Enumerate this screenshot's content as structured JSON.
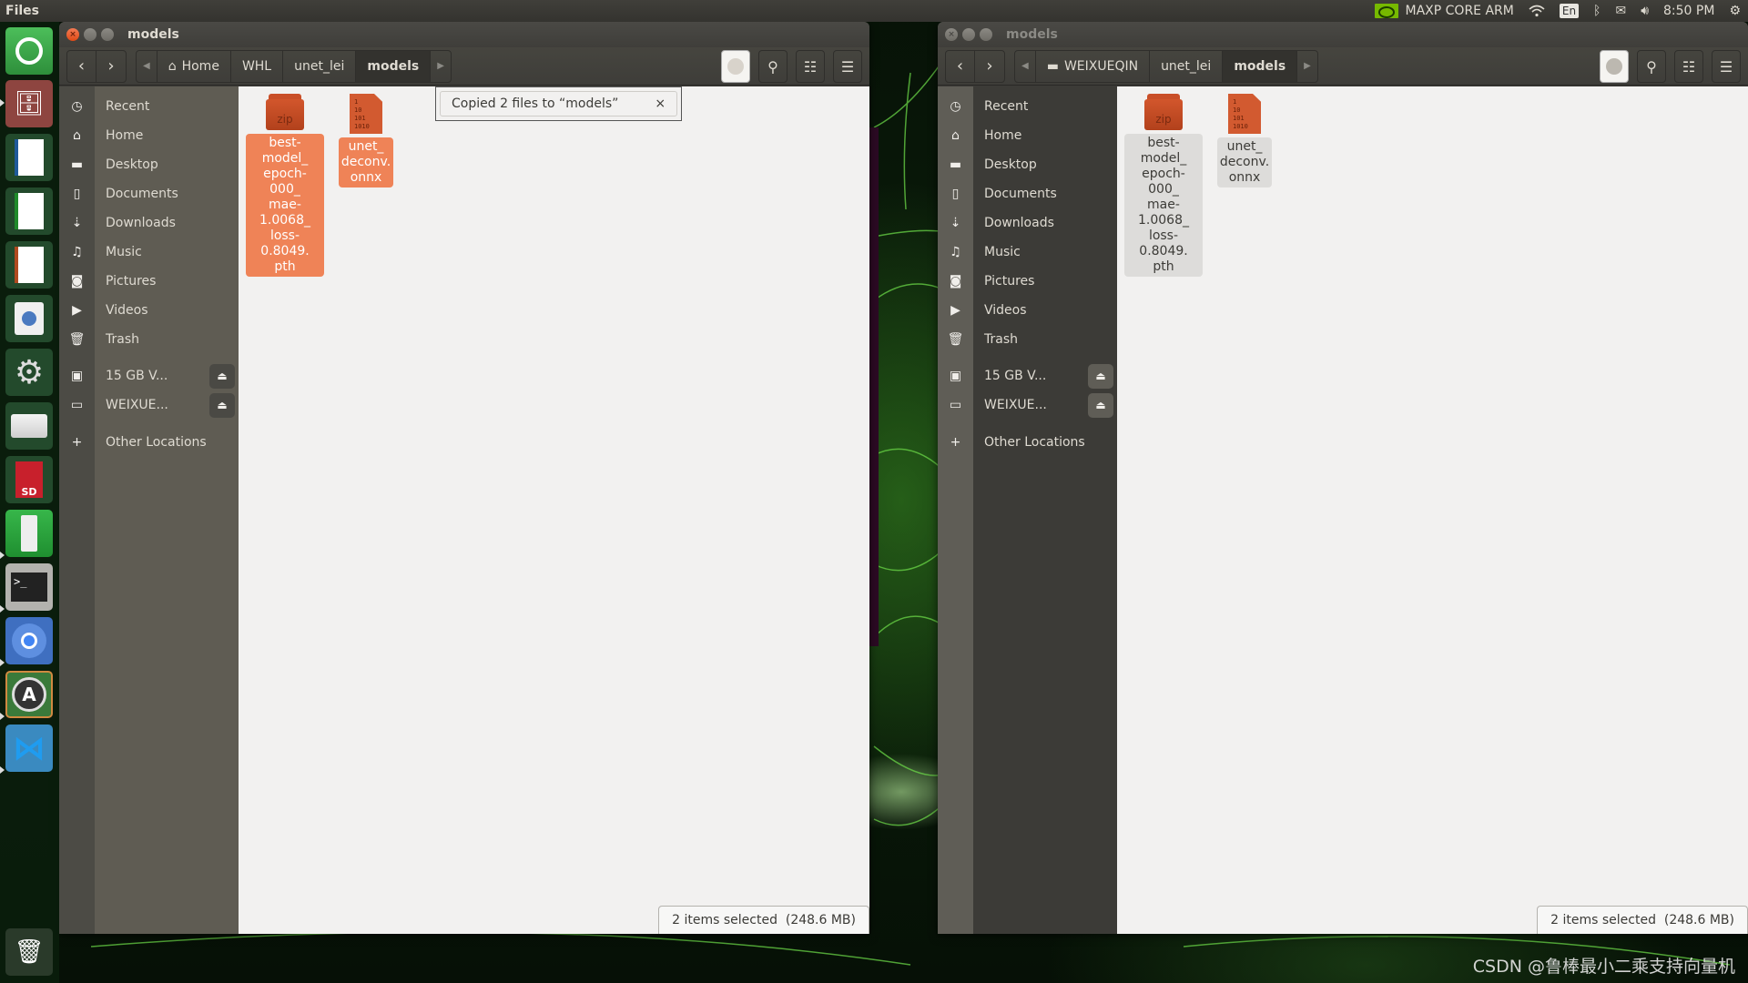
{
  "topbar": {
    "app_name": "Files",
    "gpu_label": "MAXP CORE ARM",
    "keyboard_layout": "En",
    "clock": "8:50 PM"
  },
  "launcher": {
    "items": [
      {
        "name": "ubuntu-dash",
        "color": "#3aa44a"
      },
      {
        "name": "files",
        "color": "#9a4a45"
      },
      {
        "name": "libreoffice-writer",
        "color": "#2a5e3a"
      },
      {
        "name": "libreoffice-calc",
        "color": "#2a5e3a"
      },
      {
        "name": "libreoffice-impress",
        "color": "#2a5e3a"
      },
      {
        "name": "software-center",
        "color": "#2a5e3a"
      },
      {
        "name": "system-settings",
        "color": "#2a5e3a"
      },
      {
        "name": "drive",
        "color": "#2a5e3a"
      },
      {
        "name": "sd-card",
        "color": "#2a5e3a"
      },
      {
        "name": "usb-drive",
        "color": "#2a9a3a"
      },
      {
        "name": "terminal",
        "color": "#9a9995"
      },
      {
        "name": "chromium",
        "color": "#3f6fc0"
      },
      {
        "name": "software-updater",
        "color": "#3a7a3a"
      },
      {
        "name": "vscode",
        "color": "#3a8ac0"
      }
    ],
    "trash": "trash"
  },
  "windows": [
    {
      "title": "models",
      "active": true,
      "path": [
        {
          "label": "Home",
          "icon": "home-icon"
        },
        {
          "label": "WHL"
        },
        {
          "label": "unet_lei"
        },
        {
          "label": "models",
          "current": true
        }
      ],
      "sidebar": {
        "places": [
          "Recent",
          "Home",
          "Desktop",
          "Documents",
          "Downloads",
          "Music",
          "Pictures",
          "Videos",
          "Trash"
        ],
        "devices": [
          "15 GB V...",
          "WEIXUE..."
        ],
        "other": "Other Locations"
      },
      "files": [
        {
          "name": "best-\nmodel_\nepoch-000_\nmae-\n1.0068_\nloss-0.8049.\npth",
          "type": "zip",
          "selected": true
        },
        {
          "name": "unet_\ndeconv.\nonnx",
          "type": "binary",
          "selected": true
        }
      ],
      "toast": {
        "message": "Copied 2 files to “models”",
        "close": "×"
      },
      "status": "2 items selected  (248.6 MB)"
    },
    {
      "title": "models",
      "active": false,
      "path": [
        {
          "label": "WEIXUEQIN",
          "icon": "drive-icon"
        },
        {
          "label": "unet_lei"
        },
        {
          "label": "models",
          "current": true
        }
      ],
      "sidebar": {
        "places": [
          "Recent",
          "Home",
          "Desktop",
          "Documents",
          "Downloads",
          "Music",
          "Pictures",
          "Videos",
          "Trash"
        ],
        "devices": [
          "15 GB V...",
          "WEIXUE..."
        ],
        "other": "Other Locations"
      },
      "files": [
        {
          "name": "best-\nmodel_\nepoch-000_\nmae-\n1.0068_\nloss-0.8049.\npth",
          "type": "zip",
          "selected": true
        },
        {
          "name": "unet_\ndeconv.\nonnx",
          "type": "binary",
          "selected": true
        }
      ],
      "status": "2 items selected  (248.6 MB)"
    }
  ],
  "binary_icon_text": [
    "1",
    "10",
    "101",
    "1010"
  ],
  "zip_label": "zip",
  "watermark": "CSDN @鲁棒最小二乘支持向量机"
}
